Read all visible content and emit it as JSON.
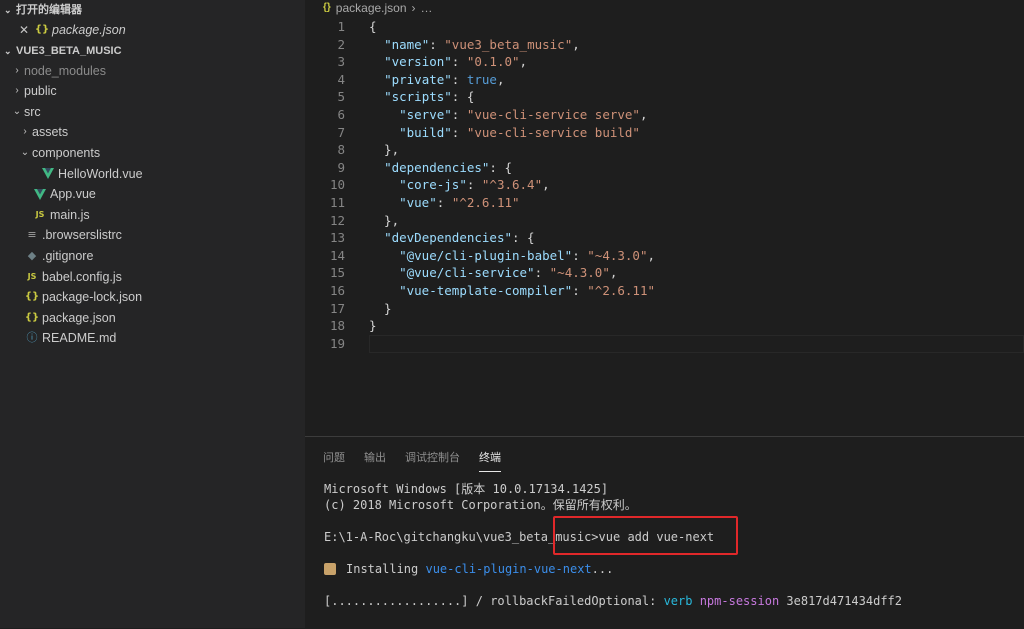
{
  "sidebar": {
    "open_editors_title": "打开的编辑器",
    "open_editor_file": "package.json",
    "project_title": "VUE3_BETA_MUSIC",
    "tree": [
      {
        "label": "node_modules",
        "indent": 0,
        "twistie": "›",
        "icon": "",
        "dim": true
      },
      {
        "label": "public",
        "indent": 0,
        "twistie": "›",
        "icon": ""
      },
      {
        "label": "src",
        "indent": 0,
        "twistie": "⌄",
        "icon": ""
      },
      {
        "label": "assets",
        "indent": 1,
        "twistie": "›",
        "icon": ""
      },
      {
        "label": "components",
        "indent": 1,
        "twistie": "⌄",
        "icon": ""
      },
      {
        "label": "HelloWorld.vue",
        "indent": 2,
        "twistie": "",
        "icon": "vue"
      },
      {
        "label": "App.vue",
        "indent": 1,
        "twistie": "",
        "icon": "vue"
      },
      {
        "label": "main.js",
        "indent": 1,
        "twistie": "",
        "icon": "js"
      },
      {
        "label": ".browserslistrc",
        "indent": 0,
        "twistie": "",
        "icon": "lines"
      },
      {
        "label": ".gitignore",
        "indent": 0,
        "twistie": "",
        "icon": "diamond"
      },
      {
        "label": "babel.config.js",
        "indent": 0,
        "twistie": "",
        "icon": "js"
      },
      {
        "label": "package-lock.json",
        "indent": 0,
        "twistie": "",
        "icon": "json"
      },
      {
        "label": "package.json",
        "indent": 0,
        "twistie": "",
        "icon": "json"
      },
      {
        "label": "README.md",
        "indent": 0,
        "twistie": "",
        "icon": "info"
      }
    ]
  },
  "editor": {
    "breadcrumb_file": "package.json",
    "breadcrumb_more": "…",
    "lines": [
      [
        [
          "p",
          "{"
        ]
      ],
      [
        [
          "p",
          "  "
        ],
        [
          "k",
          "\"name\""
        ],
        [
          "p",
          ": "
        ],
        [
          "s",
          "\"vue3_beta_music\""
        ],
        [
          "p",
          ","
        ]
      ],
      [
        [
          "p",
          "  "
        ],
        [
          "k",
          "\"version\""
        ],
        [
          "p",
          ": "
        ],
        [
          "s",
          "\"0.1.0\""
        ],
        [
          "p",
          ","
        ]
      ],
      [
        [
          "p",
          "  "
        ],
        [
          "k",
          "\"private\""
        ],
        [
          "p",
          ": "
        ],
        [
          "b",
          "true"
        ],
        [
          "p",
          ","
        ]
      ],
      [
        [
          "p",
          "  "
        ],
        [
          "k",
          "\"scripts\""
        ],
        [
          "p",
          ": {"
        ]
      ],
      [
        [
          "p",
          "    "
        ],
        [
          "k",
          "\"serve\""
        ],
        [
          "p",
          ": "
        ],
        [
          "s",
          "\"vue-cli-service serve\""
        ],
        [
          "p",
          ","
        ]
      ],
      [
        [
          "p",
          "    "
        ],
        [
          "k",
          "\"build\""
        ],
        [
          "p",
          ": "
        ],
        [
          "s",
          "\"vue-cli-service build\""
        ]
      ],
      [
        [
          "p",
          "  },"
        ]
      ],
      [
        [
          "p",
          "  "
        ],
        [
          "k",
          "\"dependencies\""
        ],
        [
          "p",
          ": {"
        ]
      ],
      [
        [
          "p",
          "    "
        ],
        [
          "k",
          "\"core-js\""
        ],
        [
          "p",
          ": "
        ],
        [
          "s",
          "\"^3.6.4\""
        ],
        [
          "p",
          ","
        ]
      ],
      [
        [
          "p",
          "    "
        ],
        [
          "k",
          "\"vue\""
        ],
        [
          "p",
          ": "
        ],
        [
          "s",
          "\"^2.6.11\""
        ]
      ],
      [
        [
          "p",
          "  },"
        ]
      ],
      [
        [
          "p",
          "  "
        ],
        [
          "k",
          "\"devDependencies\""
        ],
        [
          "p",
          ": {"
        ]
      ],
      [
        [
          "p",
          "    "
        ],
        [
          "k",
          "\"@vue/cli-plugin-babel\""
        ],
        [
          "p",
          ": "
        ],
        [
          "s",
          "\"~4.3.0\""
        ],
        [
          "p",
          ","
        ]
      ],
      [
        [
          "p",
          "    "
        ],
        [
          "k",
          "\"@vue/cli-service\""
        ],
        [
          "p",
          ": "
        ],
        [
          "s",
          "\"~4.3.0\""
        ],
        [
          "p",
          ","
        ]
      ],
      [
        [
          "p",
          "    "
        ],
        [
          "k",
          "\"vue-template-compiler\""
        ],
        [
          "p",
          ": "
        ],
        [
          "s",
          "\"^2.6.11\""
        ]
      ],
      [
        [
          "p",
          "  }"
        ]
      ],
      [
        [
          "p",
          "}"
        ]
      ],
      [
        [
          "p",
          ""
        ]
      ]
    ]
  },
  "panel": {
    "tabs": [
      "问题",
      "输出",
      "调试控制台",
      "终端"
    ],
    "active_tab": 3,
    "terminal": {
      "line1": "Microsoft Windows [版本 10.0.17134.1425]",
      "line2": "(c) 2018 Microsoft Corporation。保留所有权利。",
      "prompt": "E:\\1-A-Roc\\gitchangku\\vue3_beta_music>",
      "command": "vue add vue-next",
      "installing_label": "Installing ",
      "installing_pkg": "vue-cli-plugin-vue-next",
      "installing_suffix": "...",
      "progress_bar": "[..................]",
      "progress_sep": " / ",
      "progress_task": "rollbackFailedOptional: ",
      "verb": "verb ",
      "session_key": "npm-session ",
      "session_id": "3e817d471434dff2"
    }
  },
  "colors": {
    "highlight_box": "#e0282a",
    "vue_green": "#41b883",
    "json_yellow": "#cbcb41"
  }
}
